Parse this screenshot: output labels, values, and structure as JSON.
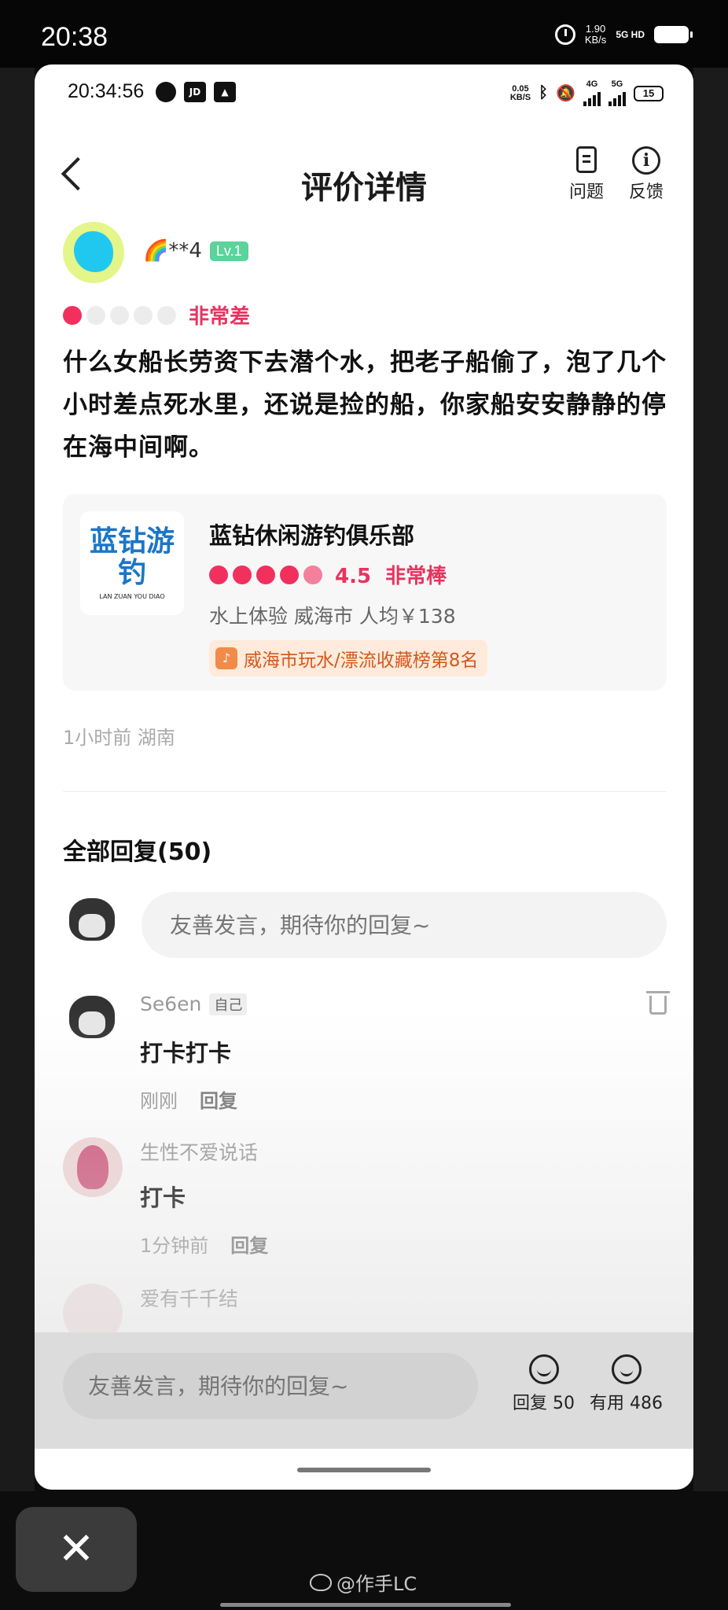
{
  "outer_status": {
    "time": "20:38",
    "speed_value": "1.90",
    "speed_unit": "KB/s",
    "network": "5G HD"
  },
  "inner_status": {
    "time": "20:34:56",
    "app_badge": "JD",
    "speed_value": "0.05",
    "speed_unit": "KB/S",
    "net4g": "4G",
    "net5g": "5G",
    "battery": "15"
  },
  "nav": {
    "title": "评价详情",
    "question_label": "问题",
    "feedback_label": "反馈"
  },
  "review": {
    "username": "🌈**4",
    "level": "Lv.1",
    "rating_hearts": 1,
    "rating_max": 5,
    "rating_text": "非常差",
    "content": "什么女船长劳资下去潜个水，把老子船偷了，泡了几个小时差点死水里，还说是捡的船，你家船安安静静的停在海中间啊。",
    "time_location": "1小时前  湖南"
  },
  "shop": {
    "logo_text": "蓝钻游钓",
    "logo_sub": "LAN ZUAN YOU DIAO",
    "name": "蓝钻休闲游钓俱乐部",
    "score": "4.5",
    "score_text": "非常棒",
    "meta": "水上体验  威海市  人均￥138",
    "rank": "威海市玩水/漂流收藏榜第8名"
  },
  "replies": {
    "title": "全部回复(50)",
    "input_placeholder": "友善发言，期待你的回复~",
    "items": [
      {
        "name": "Se6en",
        "tag": "自己",
        "text": "打卡打卡",
        "time": "刚刚",
        "reply": "回复"
      },
      {
        "name": "生性不爱说话",
        "text": "打卡",
        "time": "1分钟前",
        "reply": "回复"
      },
      {
        "name": "爱有千千结"
      }
    ]
  },
  "bottom_bar": {
    "input_placeholder": "友善发言，期待你的回复~",
    "reply_label": "回复 50",
    "useful_label": "有用 486"
  },
  "overlay": {
    "close": "✕",
    "watermark": "@作手LC"
  }
}
